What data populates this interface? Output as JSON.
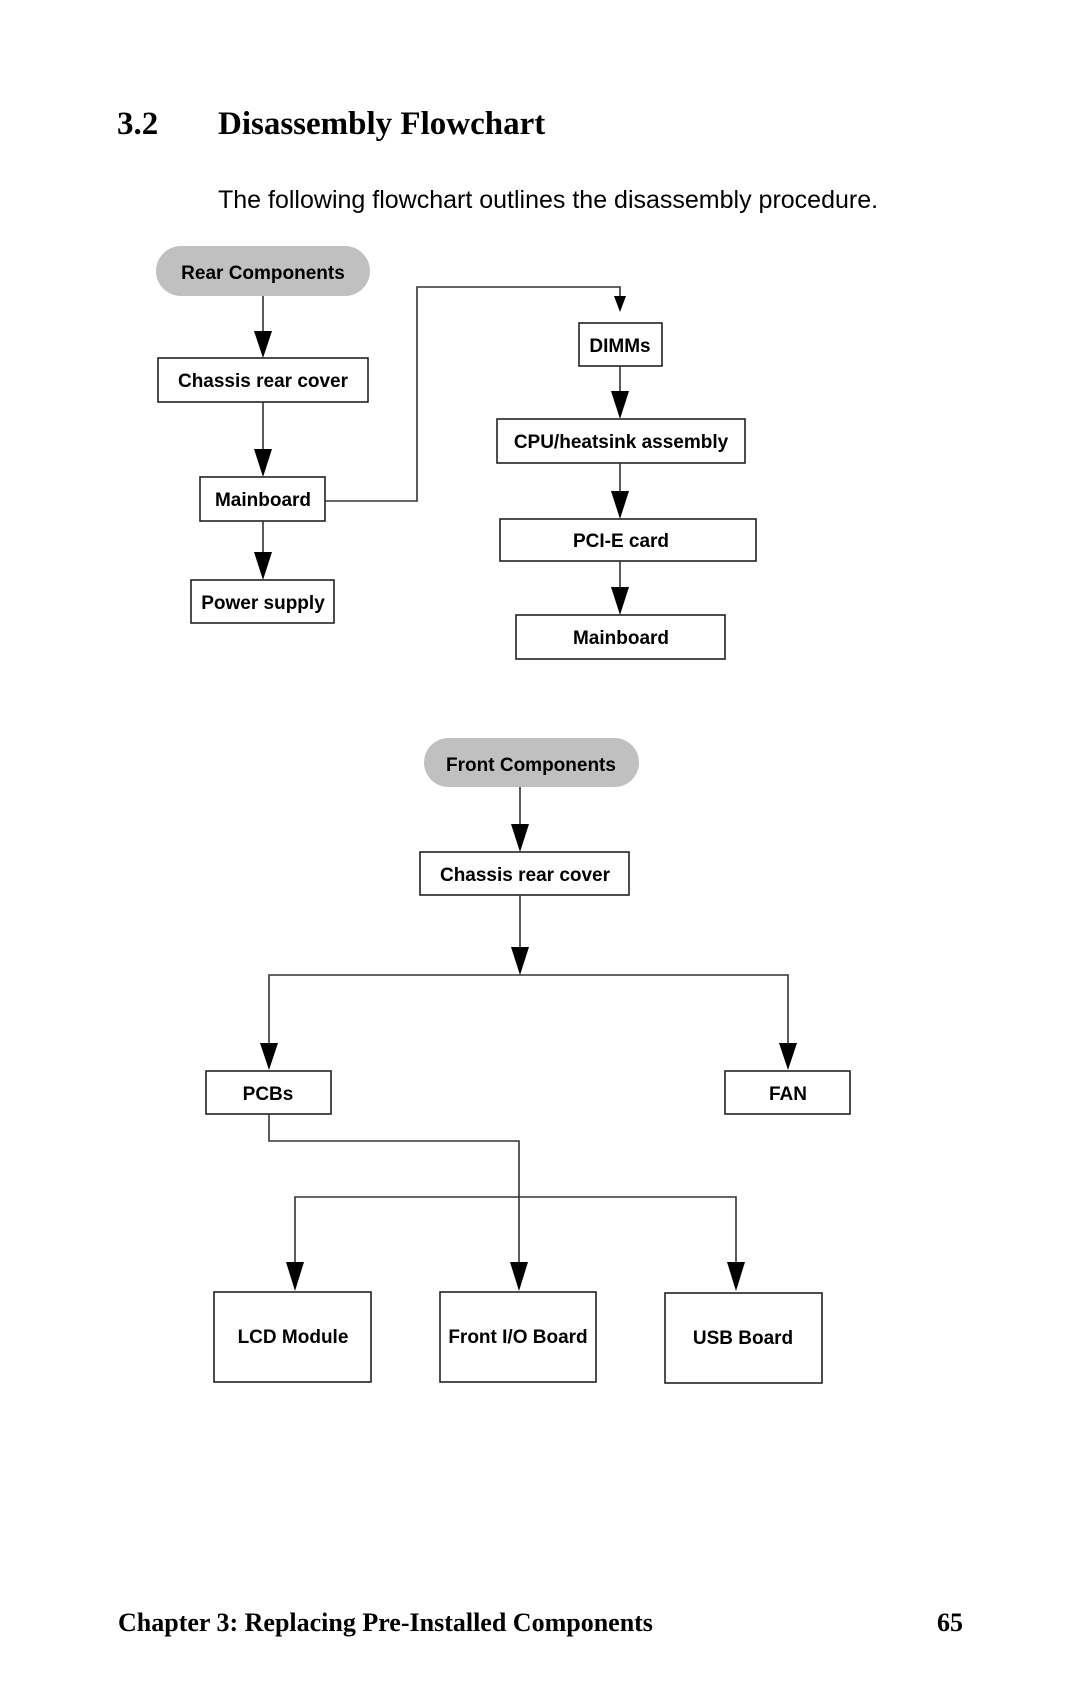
{
  "section": {
    "number": "3.2",
    "title": "Disassembly Flowchart",
    "intro": "The following flowchart outlines the disassembly procedure."
  },
  "rear_flow": {
    "start": "Rear Components",
    "nodes": {
      "chassis": "Chassis rear cover",
      "mainboard": "Mainboard",
      "power": "Power supply",
      "dimms": "DIMMs",
      "cpu": "CPU/heatsink assembly",
      "pcie": "PCI-E card",
      "mainboard2": "Mainboard"
    }
  },
  "front_flow": {
    "start": "Front Components",
    "nodes": {
      "chassis": "Chassis rear cover",
      "pcbs": "PCBs",
      "fan": "FAN",
      "lcd": "LCD Module",
      "frontio": "Front I/O Board",
      "usb": "USB Board"
    }
  },
  "footer": {
    "chapter": "Chapter 3: Replacing Pre-Installed Components",
    "page": "65"
  }
}
